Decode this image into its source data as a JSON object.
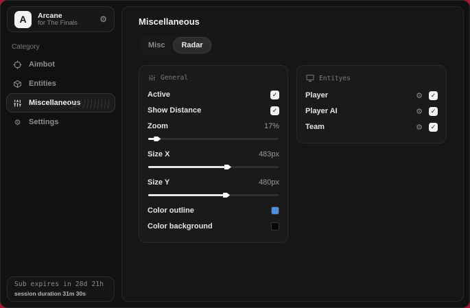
{
  "icons": {
    "gear_glyph": "⚙",
    "check_glyph": "✓"
  },
  "colors": {
    "backdrop": "#a81634",
    "accent_blue": "#4e8ee0",
    "swatch_black": "#050505"
  },
  "sidebar": {
    "brand": {
      "logo_letter": "A",
      "title": "Arcane",
      "subtitle": "for The Finals"
    },
    "category_label": "Category",
    "items": [
      {
        "label": "Aimbot",
        "icon": "crosshair-icon",
        "active": false
      },
      {
        "label": "Entities",
        "icon": "cube-icon",
        "active": false
      },
      {
        "label": "Miscellaneous",
        "icon": "sliders-icon",
        "active": true
      },
      {
        "label": "Settings",
        "icon": "gear-icon",
        "active": false
      }
    ],
    "subscription": {
      "expiry_text": "Sub expires in 28d 21h",
      "session_text": "session duration 31m 30s"
    }
  },
  "main": {
    "title": "Miscellaneous",
    "tabs": [
      {
        "label": "Misc",
        "active": false
      },
      {
        "label": "Radar",
        "active": true
      }
    ],
    "general_panel": {
      "header": "General",
      "toggles": [
        {
          "label": "Active",
          "checked": true
        },
        {
          "label": "Show Distance",
          "checked": true
        }
      ],
      "sliders": [
        {
          "label": "Zoom",
          "value": "17%",
          "fill_percent": 6
        },
        {
          "label": "Size X",
          "value": "483px",
          "fill_percent": 60
        },
        {
          "label": "Size Y",
          "value": "480px",
          "fill_percent": 59
        }
      ],
      "color_rows": [
        {
          "label": "Color outline",
          "swatch": "#4e8ee0"
        },
        {
          "label": "Color background",
          "swatch": "#050505"
        }
      ]
    },
    "entities_panel": {
      "header": "Entityes",
      "rows": [
        {
          "label": "Player",
          "checked": true
        },
        {
          "label": "Player AI",
          "checked": true
        },
        {
          "label": "Team",
          "checked": true
        }
      ]
    }
  }
}
